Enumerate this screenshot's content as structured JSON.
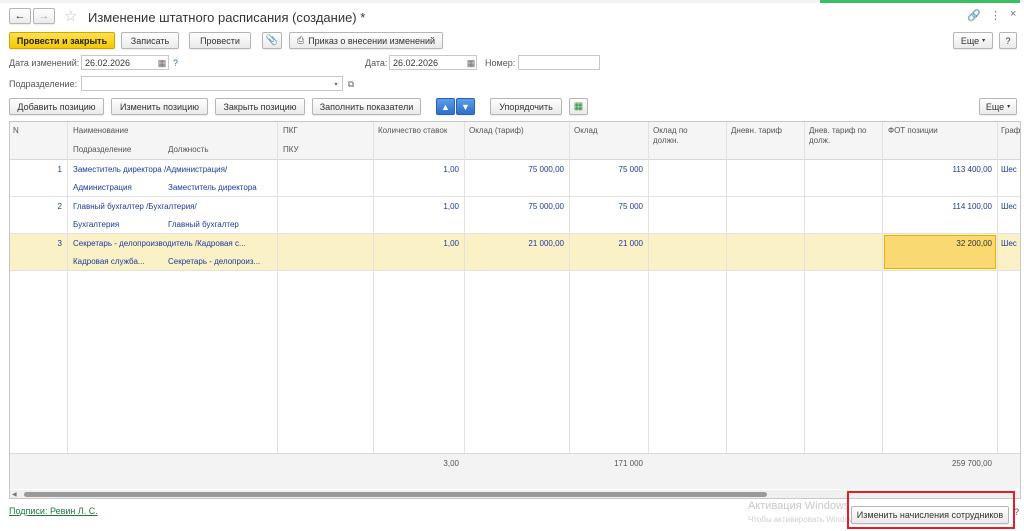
{
  "window": {
    "title": "Изменение штатного расписания (создание) *"
  },
  "toolbar": {
    "post_close": "Провести и закрыть",
    "save": "Записать",
    "post": "Провести",
    "order": "Приказ о внесении изменений",
    "more": "Еще",
    "help": "?"
  },
  "form": {
    "date_change_label": "Дата изменений:",
    "date_change_value": "26.02.2026",
    "date_label": "Дата:",
    "date_value": "26.02.2026",
    "number_label": "Номер:",
    "number_value": "",
    "department_label": "Подразделение:",
    "department_value": "",
    "help_mark": "?"
  },
  "actions": {
    "add": "Добавить позицию",
    "change": "Изменить позицию",
    "close": "Закрыть позицию",
    "fill": "Заполнить показатели",
    "order": "Упорядочить",
    "more": "Еще"
  },
  "table": {
    "headers": {
      "n": "N",
      "name": "Наименование",
      "dept": "Подразделение",
      "position": "Должность",
      "pkg": "ПКГ",
      "pku": "ПКУ",
      "qty": "Количество ставок",
      "rate_tariff": "Оклад (тариф)",
      "rate": "Оклад",
      "rate_pos1": "Оклад по",
      "rate_pos2": "должн.",
      "day_tariff": "Дневн. тариф",
      "day_tariff_pos1": "Днев. тариф по",
      "day_tariff_pos2": "долж.",
      "fot": "ФОТ позиции",
      "sched": "Граф"
    },
    "rows": [
      {
        "n": "1",
        "name": "Заместитель директора /Администрация/",
        "dept": "Администрация",
        "position": "Заместитель директора",
        "qty": "1,00",
        "rate_tariff": "75 000,00",
        "rate": "75 000",
        "fot": "113 400,00",
        "sched": "Шес"
      },
      {
        "n": "2",
        "name": "Главный бухгалтер /Бухгалтерия/",
        "dept": "Бухгалтерия",
        "position": "Главный бухгалтер",
        "qty": "1,00",
        "rate_tariff": "75 000,00",
        "rate": "75 000",
        "fot": "114 100,00",
        "sched": "Шес"
      },
      {
        "n": "3",
        "name": "Секретарь - делопроизводитель /Кадровая с...",
        "dept": "Кадровая служба...",
        "position": "Секретарь - делопроиз...",
        "qty": "1,00",
        "rate_tariff": "21 000,00",
        "rate": "21 000",
        "fot": "32 200,00",
        "sched": "Шес"
      }
    ],
    "totals": {
      "qty": "3,00",
      "rate": "171 000",
      "fot": "259 700,00"
    }
  },
  "footer": {
    "signatures": "Подписи: Ревин Л. С.",
    "change_accruals": "Изменить начисления сотрудников",
    "help": "?",
    "activation_title": "Активация Windows",
    "activation_text": "Чтобы активировать Windows, перейдите в \"Параметры\"."
  },
  "colors": {
    "accent": "#f5c800",
    "selection": "#fbf1c6",
    "link_green": "#1f7a3a",
    "data_blue": "#1c3a9c",
    "highlight_red": "#e31e24"
  }
}
